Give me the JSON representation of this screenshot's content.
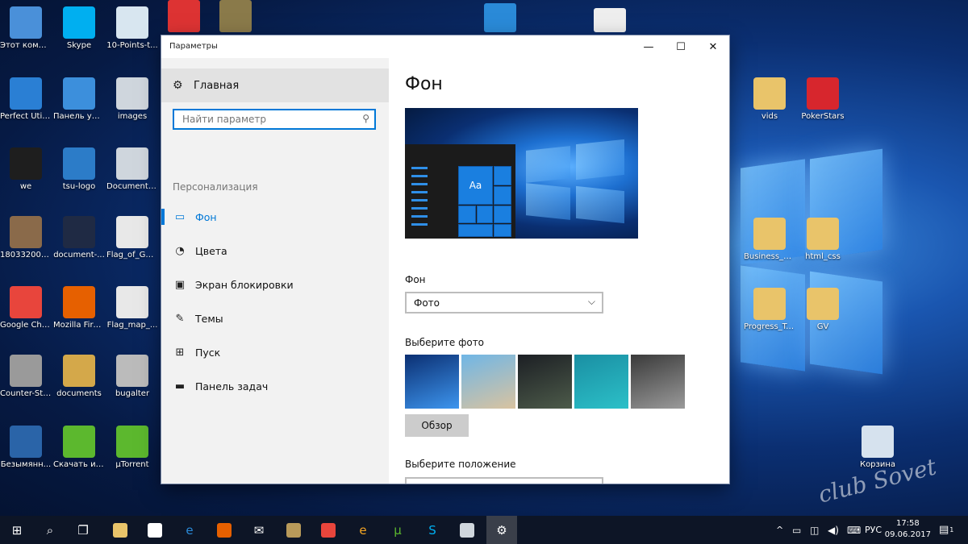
{
  "desktop": {
    "icons": [
      {
        "label": "Этот компьютер",
        "icon": "computer-icon",
        "color": "#4a90d9"
      },
      {
        "label": "Skype",
        "icon": "skype-icon",
        "color": "#00aff0"
      },
      {
        "label": "10-Points-t...",
        "icon": "image-file-icon",
        "color": "#d8e6f0"
      },
      {
        "label": "Perfect Utilities",
        "icon": "utilities-icon",
        "color": "#2a7fd4"
      },
      {
        "label": "Панель управления",
        "icon": "control-panel-icon",
        "color": "#3c8fdc"
      },
      {
        "label": "images",
        "icon": "folder-image-icon",
        "color": "#cfd6dd"
      },
      {
        "label": "we",
        "icon": "camera-icon",
        "color": "#1e1e1e"
      },
      {
        "label": "tsu-logo",
        "icon": "logo-file-icon",
        "color": "#2c7cc8"
      },
      {
        "label": "Document_...",
        "icon": "document-image-icon",
        "color": "#cfd6dd"
      },
      {
        "label": "18033200_1...",
        "icon": "photo-file-icon",
        "color": "#8a6a4a"
      },
      {
        "label": "document-...",
        "icon": "document-file-icon",
        "color": "#1f2a44"
      },
      {
        "label": "Flag_of_Ge...",
        "icon": "flag-file-icon",
        "color": "#e8e8e8"
      },
      {
        "label": "Google Chrome",
        "icon": "chrome-icon",
        "color": "#e8453c"
      },
      {
        "label": "Mozilla Firefox",
        "icon": "firefox-icon",
        "color": "#e66000"
      },
      {
        "label": "Flag_map_...",
        "icon": "flag-map-icon",
        "color": "#e8e8e8"
      },
      {
        "label": "Counter-Str...",
        "icon": "counter-strike-icon",
        "color": "#9a9a9a"
      },
      {
        "label": "documents",
        "icon": "documents-icon",
        "color": "#d4a84a"
      },
      {
        "label": "bugalter",
        "icon": "bugalter-icon",
        "color": "#bbbbbb"
      },
      {
        "label": "Безымянн...",
        "icon": "unnamed-file-icon",
        "color": "#2a64a8"
      },
      {
        "label": "Скачать игры чер...",
        "icon": "utorrent-download-icon",
        "color": "#5cb82e"
      },
      {
        "label": "µTorrent",
        "icon": "utorrent-icon",
        "color": "#5cb82e"
      },
      {
        "label": "vids",
        "icon": "folder-icon",
        "color": "#e9c46a"
      },
      {
        "label": "PokerStars",
        "icon": "pokerstars-icon",
        "color": "#d7262d"
      },
      {
        "label": "Business_Sk...",
        "icon": "folder-icon",
        "color": "#e9c46a"
      },
      {
        "label": "html_css",
        "icon": "word-file-icon",
        "color": "#e9c46a"
      },
      {
        "label": "Progress_Te...",
        "icon": "folder-icon",
        "color": "#e9c46a"
      },
      {
        "label": "GV",
        "icon": "pdf-file-icon",
        "color": "#e9c46a"
      },
      {
        "label": "Корзина",
        "icon": "recycle-bin-icon",
        "color": "#d6e2ee"
      }
    ],
    "top_row_partial": [
      {
        "icon": "pdf-file-icon",
        "color": "#d33"
      },
      {
        "icon": "game-shield-icon",
        "color": "#8a7a4a"
      },
      {
        "icon": "app-a-icon",
        "color": "#2a8ad8"
      },
      {
        "icon": "document-list-icon",
        "color": "#eeeeee"
      }
    ],
    "watermark": "club Sovet"
  },
  "window": {
    "title": "Параметры",
    "controls": {
      "minimize": "—",
      "maximize": "☐",
      "close": "✕"
    },
    "sidebar": {
      "home_label": "Главная",
      "search_placeholder": "Найти параметр",
      "section_label": "Персонализация",
      "items": [
        {
          "label": "Фон",
          "icon": "image-icon",
          "glyph": "▭",
          "active": true
        },
        {
          "label": "Цвета",
          "icon": "palette-icon",
          "glyph": "◔",
          "active": false
        },
        {
          "label": "Экран блокировки",
          "icon": "lock-screen-icon",
          "glyph": "▣",
          "active": false
        },
        {
          "label": "Темы",
          "icon": "themes-icon",
          "glyph": "✎",
          "active": false
        },
        {
          "label": "Пуск",
          "icon": "start-icon",
          "glyph": "⊞",
          "active": false
        },
        {
          "label": "Панель задач",
          "icon": "taskbar-icon",
          "glyph": "▬",
          "active": false
        }
      ]
    },
    "main": {
      "page_title": "Фон",
      "preview_tile_text": "Aa",
      "background_label": "Фон",
      "background_value": "Фото",
      "choose_photo_label": "Выберите фото",
      "browse_button": "Обзор",
      "position_label": "Выберите положение",
      "thumbnails": [
        {
          "name": "windows-blue",
          "colors": [
            "#0b2f72",
            "#3d95ee"
          ]
        },
        {
          "name": "beach-sunset",
          "colors": [
            "#6fb6e6",
            "#d9c3a0"
          ]
        },
        {
          "name": "night-tent",
          "colors": [
            "#1c1f24",
            "#4d5b4a"
          ]
        },
        {
          "name": "underwater-swimmer",
          "colors": [
            "#1a8fa3",
            "#2cc0c8"
          ]
        },
        {
          "name": "rock-wall",
          "colors": [
            "#3a3a3a",
            "#9a9a9a"
          ]
        }
      ]
    }
  },
  "taskbar": {
    "apps": [
      {
        "icon": "windows-start-icon",
        "glyph": "⊞",
        "color": "#ffffff"
      },
      {
        "icon": "search-icon",
        "glyph": "⌕",
        "color": "#ffffff"
      },
      {
        "icon": "task-view-icon",
        "glyph": "❐",
        "color": "#ffffff"
      },
      {
        "icon": "file-explorer-icon",
        "glyph": "",
        "color": "#e9c46a"
      },
      {
        "icon": "store-icon",
        "glyph": "",
        "color": "#ffffff"
      },
      {
        "icon": "edge-icon",
        "glyph": "e",
        "color": "#2a8ad8"
      },
      {
        "icon": "firefox-icon",
        "glyph": "",
        "color": "#e66000"
      },
      {
        "icon": "mail-icon",
        "glyph": "✉",
        "color": "#ffffff"
      },
      {
        "icon": "archive-icon",
        "glyph": "",
        "color": "#b89a5a"
      },
      {
        "icon": "chrome-icon",
        "glyph": "",
        "color": "#e8453c"
      },
      {
        "icon": "browser-e-icon",
        "glyph": "e",
        "color": "#f5a623"
      },
      {
        "icon": "utorrent-icon",
        "glyph": "µ",
        "color": "#5cb82e"
      },
      {
        "icon": "skype-icon",
        "glyph": "S",
        "color": "#00aff0"
      },
      {
        "icon": "paint-icon",
        "glyph": "",
        "color": "#cfd6dd"
      },
      {
        "icon": "settings-gear-icon",
        "glyph": "⚙",
        "color": "#ffffff",
        "active": true
      }
    ],
    "tray": {
      "chevron": "^",
      "language": "РУС",
      "time": "17:58",
      "date": "09.06.2017",
      "notifications_count": "1"
    }
  }
}
